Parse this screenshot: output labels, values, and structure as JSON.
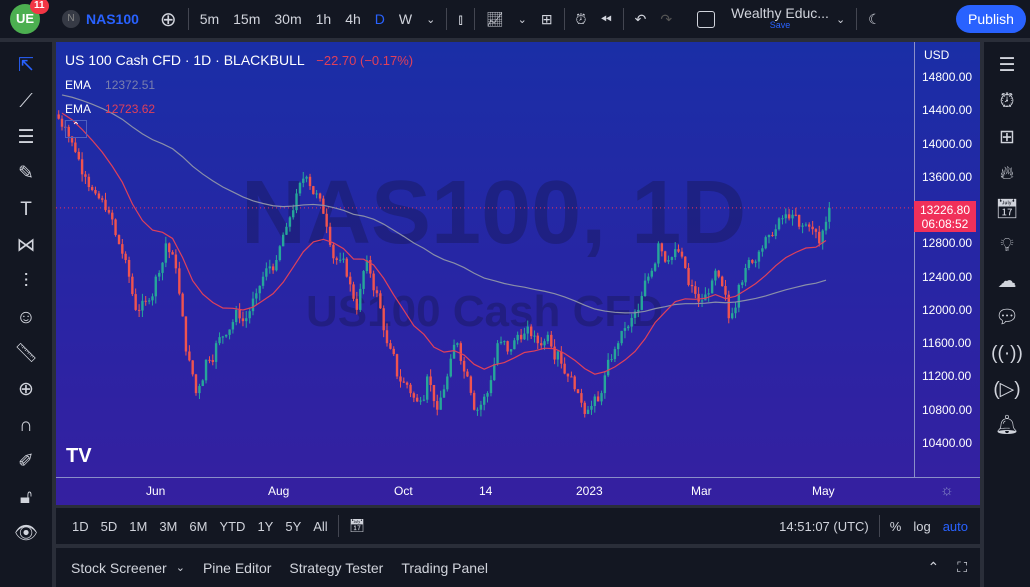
{
  "header": {
    "notif_count": "11",
    "symbol_badge": "N",
    "symbol": "NAS100",
    "intervals": [
      "5m",
      "15m",
      "30m",
      "1h",
      "4h",
      "D",
      "W"
    ],
    "active_interval": "D",
    "layout_name": "Wealthy Educ...",
    "save_label": "Save",
    "publish_label": "Publish"
  },
  "legend": {
    "title": "US 100 Cash CFD · 1D · BLACKBULL",
    "change": "−22.70 (−0.17%)",
    "ema1_label": "EMA",
    "ema1_value": "12372.51",
    "ema2_label": "EMA",
    "ema2_value": "12723.62"
  },
  "watermark": {
    "line1": "NAS100, 1D",
    "line2": "US100 Cash CFD"
  },
  "price_axis": {
    "currency": "USD",
    "labels": [
      "14800.00",
      "14400.00",
      "14000.00",
      "13600.00",
      "12800.00",
      "12400.00",
      "12000.00",
      "11600.00",
      "11200.00",
      "10800.00",
      "10400.00"
    ],
    "last_price": "13226.80",
    "countdown": "06:08:52"
  },
  "time_axis": {
    "labels": [
      "Jun",
      "Aug",
      "Oct",
      "14",
      "2023",
      "Mar",
      "May"
    ]
  },
  "bottom_toolbar": {
    "ranges": [
      "1D",
      "5D",
      "1M",
      "3M",
      "6M",
      "YTD",
      "1Y",
      "5Y",
      "All"
    ],
    "clock": "14:51:07 (UTC)",
    "percent": "%",
    "log": "log",
    "auto": "auto"
  },
  "panel_tabs": [
    "Stock Screener",
    "Pine Editor",
    "Strategy Tester",
    "Trading Panel"
  ],
  "colors": {
    "up": "#26a69a",
    "down": "#ef5350",
    "ema_fast": "#e0405a",
    "ema_slow": "#8a8fa8",
    "accent": "#2962ff"
  },
  "chart_data": {
    "type": "candlestick",
    "symbol": "NAS100",
    "timeframe": "1D",
    "ylim": [
      10200,
      15000
    ],
    "closes": [
      14200,
      13900,
      13600,
      13400,
      13200,
      12900,
      12600,
      12000,
      12100,
      12400,
      12800,
      12500,
      11500,
      11000,
      11400,
      11600,
      11700,
      12000,
      11900,
      12200,
      12500,
      12600,
      13000,
      13400,
      13600,
      13400,
      13000,
      12600,
      12400,
      12000,
      12600,
      12200,
      11600,
      11200,
      11100,
      10900,
      11200,
      10800,
      11200,
      11600,
      11200,
      10800,
      11000,
      11600,
      11500,
      11700,
      11800,
      11600,
      11700,
      11500,
      11200,
      11000,
      10800,
      10900,
      11400,
      11600,
      11800,
      12000,
      12400,
      12800,
      12600,
      12700,
      12300,
      12100,
      12200,
      12400,
      11900,
      12300,
      12600,
      12700,
      12900,
      13100,
      13100,
      13000,
      13000,
      12800,
      13226.8
    ]
  }
}
